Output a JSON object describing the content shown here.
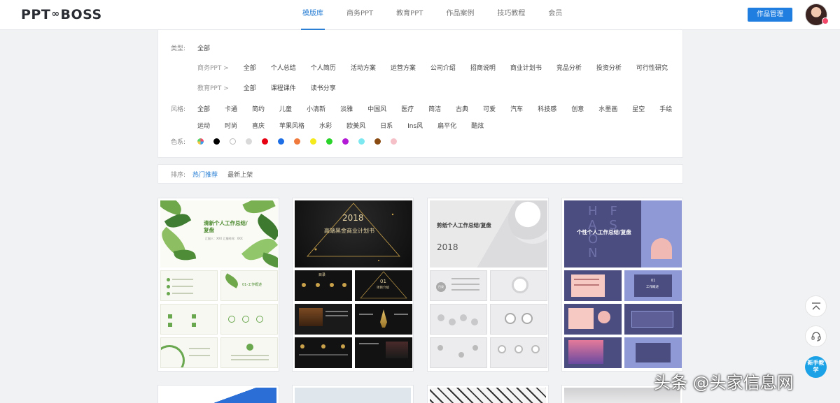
{
  "header": {
    "logo_left": "PPT",
    "logo_mid": "∞",
    "logo_right": "BOSS",
    "nav": [
      "模版库",
      "商务PPT",
      "教育PPT",
      "作品案例",
      "技巧教程",
      "会员"
    ],
    "active_nav": "模版库",
    "manage_button": "作品管理"
  },
  "filters": {
    "type_label": "类型:",
    "type_all": "全部",
    "business_label": "商务PPT >",
    "business_items": [
      "全部",
      "个人总结",
      "个人简历",
      "活动方案",
      "运营方案",
      "公司介绍",
      "招商说明",
      "商业计划书",
      "竞品分析",
      "投资分析",
      "可行性研究"
    ],
    "education_label": "教育PPT >",
    "education_items": [
      "全部",
      "课程课件",
      "读书分享"
    ],
    "style_label": "风格:",
    "style_row1": [
      "全部",
      "卡通",
      "简约",
      "儿童",
      "小清新",
      "淡雅",
      "中国风",
      "医疗",
      "简洁",
      "古典",
      "可爱",
      "汽车",
      "科技感",
      "创意",
      "水墨画",
      "星空",
      "手绘"
    ],
    "style_row2": [
      "运动",
      "时尚",
      "喜庆",
      "苹果风格",
      "水彩",
      "欧美风",
      "日系",
      "Ins风",
      "扁平化",
      "酷炫"
    ],
    "color_label": "色系:",
    "colors": [
      "#000000",
      "#ffffff",
      "#d9d9d9",
      "#e60012",
      "#1e6fe6",
      "#f07a3c",
      "#f4ea1c",
      "#2bd42b",
      "#b21ad6",
      "#7de8f0",
      "#8a4b12",
      "#f5c0c8"
    ]
  },
  "sort": {
    "label": "排序:",
    "items": [
      "热门推荐",
      "最新上架"
    ],
    "active": "热门推荐"
  },
  "cards": [
    {
      "title": "清新个人工作总结/复盘",
      "subtitle": "汇报人：XXX  汇报时间：XXX",
      "section": "01-工作概述"
    },
    {
      "year": "2018",
      "title": "高端黑金商业计划书",
      "section_num": "01",
      "section": "项目介绍",
      "contents": "目录"
    },
    {
      "title": "剪纸个人工作总结/复盘",
      "year": "2018",
      "contents": "目录"
    },
    {
      "title": "个性个人工作总结/复盘",
      "letters": "HFASON",
      "section_num": "01",
      "section": "工作概述"
    }
  ],
  "float": {
    "top_icon": "arrow-up-icon",
    "service_icon": "headset-icon",
    "new_label": "新手教学"
  },
  "watermark": "头条 @头家信息网"
}
